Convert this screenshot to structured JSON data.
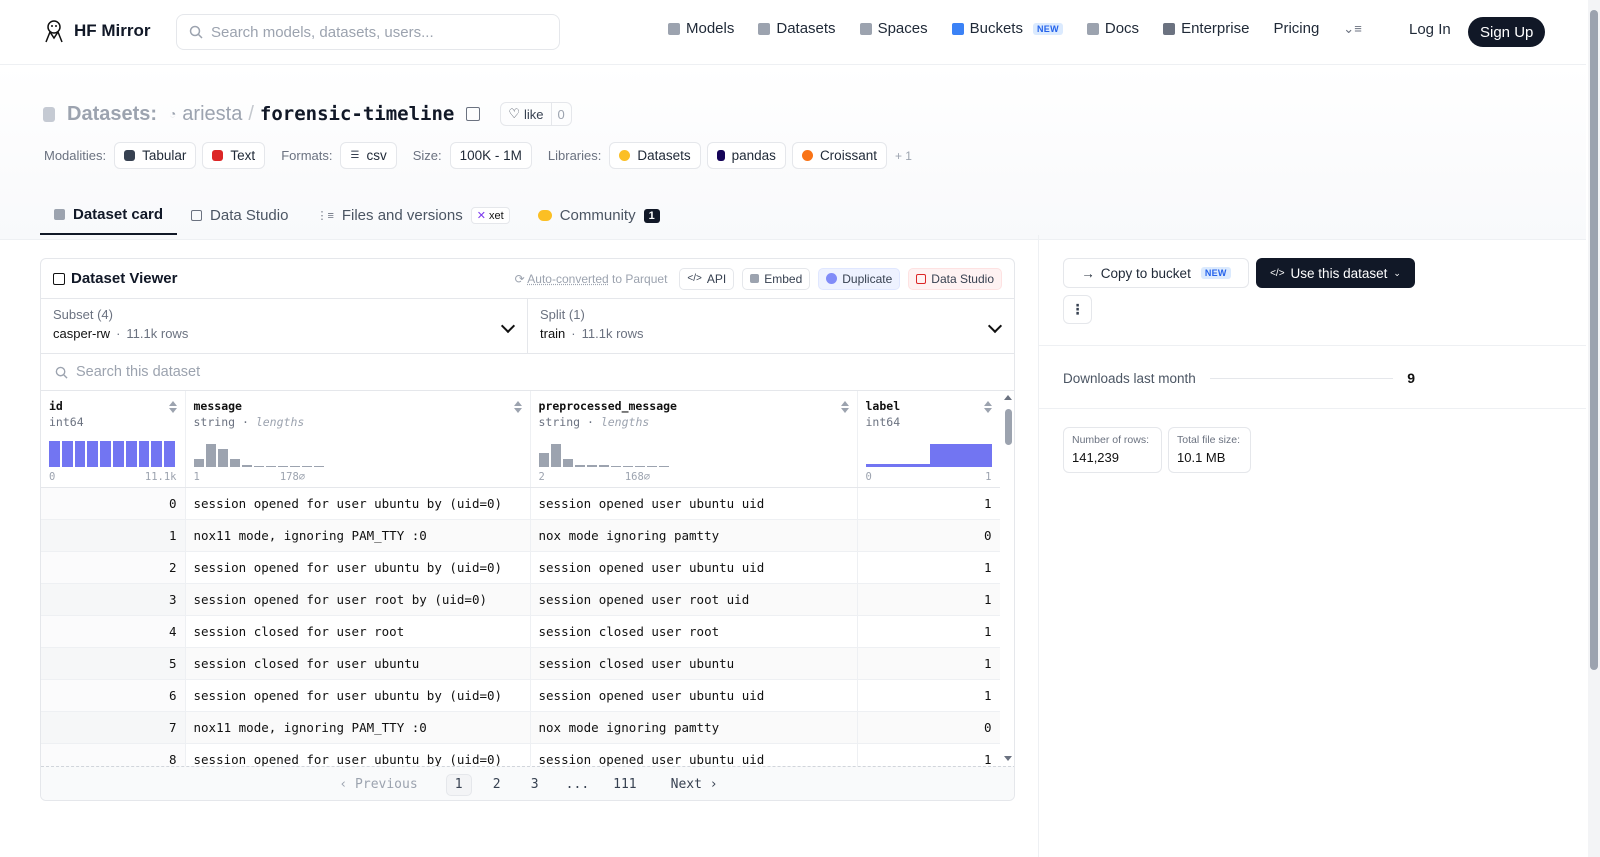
{
  "nav": {
    "brand": "HF Mirror",
    "search_placeholder": "Search models, datasets, users...",
    "links": [
      {
        "label": "Models",
        "icon": "cube-icon",
        "color": "#9ca3af"
      },
      {
        "label": "Datasets",
        "icon": "database-icon",
        "color": "#9ca3af"
      },
      {
        "label": "Spaces",
        "icon": "grid-icon",
        "color": "#9ca3af"
      },
      {
        "label": "Buckets",
        "icon": "bucket-icon",
        "color": "#3b82f6",
        "badge": "NEW"
      },
      {
        "label": "Docs",
        "icon": "book-icon",
        "color": "#9ca3af"
      },
      {
        "label": "Enterprise",
        "icon": "enterprise-icon",
        "color": "#6b7280"
      },
      {
        "label": "Pricing"
      }
    ],
    "login": "Log In",
    "signup": "Sign Up"
  },
  "header": {
    "section": "Datasets:",
    "owner": "ariesta",
    "separator": "/",
    "name": "forensic-timeline",
    "like_label": "like",
    "like_count": "0"
  },
  "meta": {
    "modalities_label": "Modalities:",
    "modalities": [
      {
        "label": "Tabular",
        "color": "#374151"
      },
      {
        "label": "Text",
        "color": "#dc2626"
      }
    ],
    "formats_label": "Formats:",
    "format": "csv",
    "size_label": "Size:",
    "size": "100K - 1M",
    "libraries_label": "Libraries:",
    "libraries": [
      {
        "label": "Datasets",
        "color": "#fbbf24"
      },
      {
        "label": "pandas",
        "color": "#150458"
      },
      {
        "label": "Croissant",
        "color": "#f97316"
      }
    ],
    "more": "+ 1"
  },
  "tabs": [
    {
      "label": "Dataset card",
      "active": true
    },
    {
      "label": "Data Studio"
    },
    {
      "label": "Files and versions",
      "badge": "xet"
    },
    {
      "label": "Community",
      "count": "1"
    }
  ],
  "viewer": {
    "title": "Dataset Viewer",
    "autoconv_link": "Auto-converted",
    "autoconv_rest": "to Parquet",
    "buttons": {
      "api": "API",
      "embed": "Embed",
      "duplicate": "Duplicate",
      "studio": "Data Studio"
    },
    "subset": {
      "label": "Subset (4)",
      "value": "casper-rw",
      "rows": "11.1k rows"
    },
    "split": {
      "label": "Split (1)",
      "value": "train",
      "rows": "11.1k rows"
    },
    "search_placeholder": "Search this dataset",
    "columns": [
      {
        "name": "id",
        "type": "int64",
        "type_extra": "",
        "min": "0",
        "max": "11.1k",
        "hist": [
          1,
          1,
          1,
          1,
          1,
          1,
          1,
          1,
          1,
          1
        ],
        "kind": "num"
      },
      {
        "name": "message",
        "type": "string",
        "type_extra": "lengths",
        "min": "1",
        "max": "178",
        "hist": [
          0.3,
          0.9,
          0.7,
          0.3,
          0.06,
          0.05,
          0.05,
          0.04,
          0.04,
          0.03,
          0.02
        ],
        "kind": "str"
      },
      {
        "name": "preprocessed_message",
        "type": "string",
        "type_extra": "lengths",
        "min": "2",
        "max": "168",
        "hist": [
          0.55,
          0.9,
          0.3,
          0.08,
          0.06,
          0.06,
          0.05,
          0.04,
          0.03,
          0.03,
          0.02
        ],
        "kind": "str"
      },
      {
        "name": "label",
        "type": "int64",
        "type_extra": "",
        "min": "0",
        "max": "1",
        "hist": [
          0.1,
          0.9
        ],
        "kind": "bin"
      }
    ],
    "rows": [
      {
        "id": "0",
        "message": "session opened for user ubuntu by (uid=0)",
        "pre": "session opened user ubuntu uid",
        "label": "1"
      },
      {
        "id": "1",
        "message": "nox11 mode, ignoring PAM_TTY :0",
        "pre": "nox mode ignoring pamtty",
        "label": "0"
      },
      {
        "id": "2",
        "message": "session opened for user ubuntu by (uid=0)",
        "pre": "session opened user ubuntu uid",
        "label": "1"
      },
      {
        "id": "3",
        "message": "session opened for user root by (uid=0)",
        "pre": "session opened user root uid",
        "label": "1"
      },
      {
        "id": "4",
        "message": "session closed for user root",
        "pre": "session closed user root",
        "label": "1"
      },
      {
        "id": "5",
        "message": "session closed for user ubuntu",
        "pre": "session closed user ubuntu",
        "label": "1"
      },
      {
        "id": "6",
        "message": "session opened for user ubuntu by (uid=0)",
        "pre": "session opened user ubuntu uid",
        "label": "1"
      },
      {
        "id": "7",
        "message": "nox11 mode, ignoring PAM_TTY :0",
        "pre": "nox mode ignoring pamtty",
        "label": "0"
      },
      {
        "id": "8",
        "message": "session opened for user ubuntu by (uid=0)",
        "pre": "session opened user ubuntu uid",
        "label": "1"
      }
    ],
    "pager": {
      "prev": "‹ Previous",
      "pages": [
        "1",
        "2",
        "3",
        "...",
        "111"
      ],
      "current": "1",
      "next": "Next ›"
    }
  },
  "sidebar": {
    "copy_bucket": "Copy to bucket",
    "copy_bucket_badge": "NEW",
    "use_dataset": "Use this dataset",
    "downloads_label": "Downloads last month",
    "downloads_value": "9",
    "rows_label": "Number of rows:",
    "rows_value": "141,239",
    "size_label": "Total file size:",
    "size_value": "10.1 MB"
  }
}
